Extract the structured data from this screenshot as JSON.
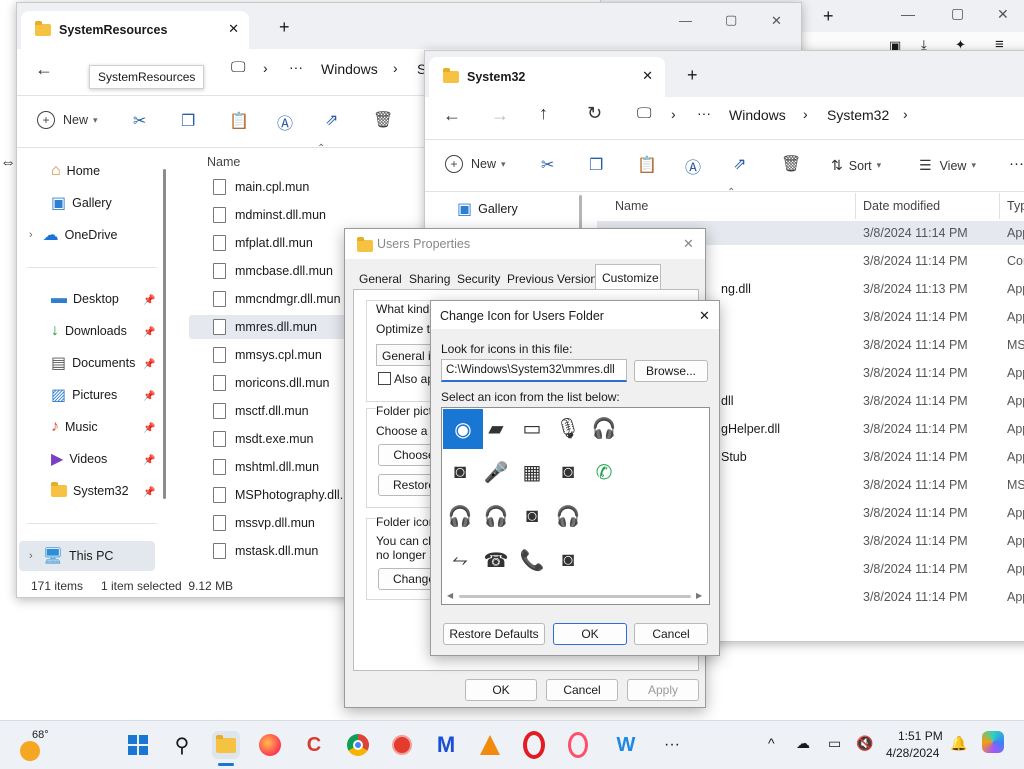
{
  "background_window": {
    "controls": {
      "min": "—",
      "max": "▢",
      "close": "✕"
    },
    "toolbar": {
      "new_tab": "+",
      "back": "←",
      "extra": "⋯"
    }
  },
  "window1": {
    "tab_title": "SystemResources",
    "tooltip": "SystemResources",
    "new_tab": "+",
    "controls": {
      "min": "—",
      "max": "▢",
      "close": "✕"
    },
    "breadcrumb": [
      "Windows",
      "S"
    ],
    "more": "···",
    "new_label": "New",
    "sidebar": [
      {
        "label": "Home",
        "icon": "home-icon"
      },
      {
        "label": "Gallery",
        "icon": "gallery-icon"
      },
      {
        "label": "OneDrive",
        "icon": "cloud-icon"
      },
      {
        "label": "Desktop",
        "icon": "desktop-icon"
      },
      {
        "label": "Downloads",
        "icon": "download-icon"
      },
      {
        "label": "Documents",
        "icon": "document-icon"
      },
      {
        "label": "Pictures",
        "icon": "picture-icon"
      },
      {
        "label": "Music",
        "icon": "music-icon"
      },
      {
        "label": "Videos",
        "icon": "video-icon"
      },
      {
        "label": "System32",
        "icon": "folder-icon"
      },
      {
        "label": "This PC",
        "icon": "pc-icon"
      }
    ],
    "column_name": "Name",
    "files": [
      "main.cpl.mun",
      "mdminst.dll.mun",
      "mfplat.dll.mun",
      "mmcbase.dll.mun",
      "mmcndmgr.dll.mun",
      "mmres.dll.mun",
      "mmsys.cpl.mun",
      "moricons.dll.mun",
      "msctf.dll.mun",
      "msdt.exe.mun",
      "mshtml.dll.mun",
      "MSPhotography.dll.mun",
      "mssvp.dll.mun",
      "mstask.dll.mun"
    ],
    "status_count": "171 items",
    "status_selected": "1 item selected  9.12 MB"
  },
  "window2": {
    "tab_title": "System32",
    "new_tab": "+",
    "breadcrumb": [
      "Windows",
      "System32"
    ],
    "new_label": "New",
    "sort_label": "Sort",
    "view_label": "View",
    "more": "···",
    "sidebar_gallery": "Gallery",
    "columns": {
      "name": "Name",
      "date": "Date modified",
      "type": "Typ"
    },
    "rows": [
      {
        "name": "",
        "date": "3/8/2024 11:14 PM",
        "type": "App"
      },
      {
        "name": "",
        "date": "3/8/2024 11:14 PM",
        "type": "Cor"
      },
      {
        "name": "ng.dll",
        "date": "3/8/2024 11:13 PM",
        "type": "App"
      },
      {
        "name": "",
        "date": "3/8/2024 11:14 PM",
        "type": "App"
      },
      {
        "name": "",
        "date": "3/8/2024 11:14 PM",
        "type": "MS"
      },
      {
        "name": "",
        "date": "3/8/2024 11:14 PM",
        "type": "App"
      },
      {
        "name": "dll",
        "date": "3/8/2024 11:14 PM",
        "type": "App"
      },
      {
        "name": "gHelper.dll",
        "date": "3/8/2024 11:14 PM",
        "type": "App"
      },
      {
        "name": "Stub",
        "date": "3/8/2024 11:14 PM",
        "type": "App"
      },
      {
        "name": "",
        "date": "3/8/2024 11:14 PM",
        "type": "MS"
      },
      {
        "name": "",
        "date": "3/8/2024 11:14 PM",
        "type": "App"
      },
      {
        "name": "",
        "date": "3/8/2024 11:14 PM",
        "type": "App"
      },
      {
        "name": "",
        "date": "3/8/2024 11:14 PM",
        "type": "App"
      },
      {
        "name": "",
        "date": "3/8/2024 11:14 PM",
        "type": "App"
      }
    ]
  },
  "users_properties": {
    "title": "Users Properties",
    "close": "✕",
    "tabs": [
      "General",
      "Sharing",
      "Security",
      "Previous Versions",
      "Customize"
    ],
    "what_kind": "What kind o",
    "optimize": "Optimize thi",
    "general_items": "General ite",
    "also_apply": "Also app",
    "folder_pictures": "Folder pictu",
    "choose_file": "Choose a fil",
    "choose_btn": "Choose",
    "restore_btn": "Restore",
    "folder_icons": "Folder icons",
    "you_can": "You can ch",
    "no_longer": "no longer sh",
    "change_btn": "Change",
    "ok": "OK",
    "cancel": "Cancel",
    "apply": "Apply"
  },
  "change_icon": {
    "title": "Change Icon for Users Folder",
    "close": "✕",
    "look_label": "Look for icons in this file:",
    "path_value": "C:\\Windows\\System32\\mmres.dll",
    "browse": "Browse...",
    "select_label": "Select an icon from the list below:",
    "icons": [
      [
        "speaker-icon",
        "device-icon",
        "monitor-icon",
        "microphone-icon",
        "headset-icon"
      ],
      [
        "speaker-box-icon",
        "microphone-stand-icon",
        "sound-card-icon",
        "speaker-box-icon",
        "phone-icon"
      ],
      [
        "headset-icon",
        "headset-mic-icon",
        "speaker-box-icon",
        "headset-icon"
      ],
      [
        "cable-icon",
        "phone-dock-icon",
        "handset-icon",
        "speaker-box-icon"
      ]
    ],
    "restore_defaults": "Restore Defaults",
    "ok": "OK",
    "cancel": "Cancel"
  },
  "taskbar": {
    "weather": "68°",
    "time": "1:51 PM",
    "date": "4/28/2024",
    "chevron": "^"
  }
}
